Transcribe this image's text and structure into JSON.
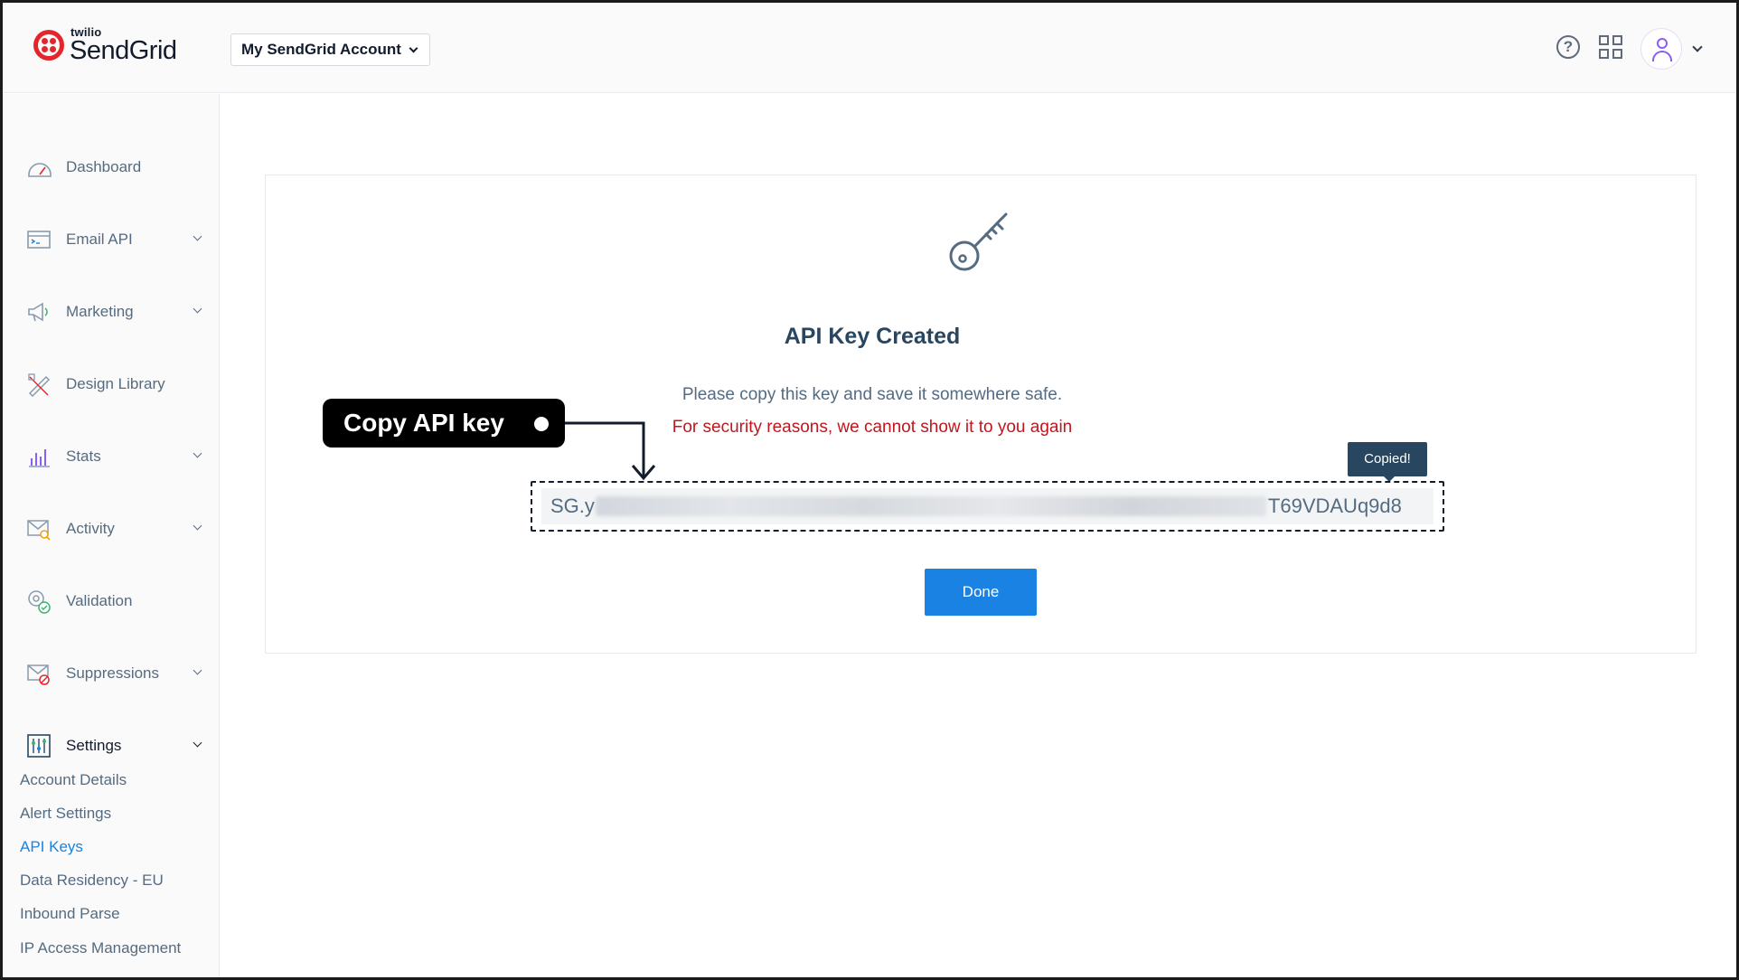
{
  "header": {
    "logo_small": "twilio",
    "logo_main": "SendGrid",
    "account_label": "My SendGrid Account",
    "help_glyph": "?"
  },
  "sidebar": {
    "items": [
      {
        "label": "Dashboard",
        "icon": "dashboard-gauge-icon",
        "expandable": false
      },
      {
        "label": "Email API",
        "icon": "terminal-window-icon",
        "expandable": true
      },
      {
        "label": "Marketing",
        "icon": "megaphone-icon",
        "expandable": true
      },
      {
        "label": "Design Library",
        "icon": "pencil-ruler-icon",
        "expandable": false
      },
      {
        "label": "Stats",
        "icon": "bar-chart-icon",
        "expandable": true
      },
      {
        "label": "Activity",
        "icon": "envelope-search-icon",
        "expandable": true
      },
      {
        "label": "Validation",
        "icon": "at-sign-check-icon",
        "expandable": false
      },
      {
        "label": "Suppressions",
        "icon": "envelope-block-icon",
        "expandable": true
      },
      {
        "label": "Settings",
        "icon": "sliders-icon",
        "expandable": true
      }
    ],
    "settings_subitems": [
      "Account Details",
      "Alert Settings",
      "API Keys",
      "Data Residency - EU",
      "Inbound Parse",
      "IP Access Management"
    ],
    "selected_subitem": "API Keys"
  },
  "main": {
    "title": "API Key Created",
    "message": "Please copy this key and save it somewhere safe.",
    "warning": "For security reasons, we cannot show it to you again",
    "key_prefix": "SG.y",
    "key_suffix": "T69VDAUq9d8",
    "copied_tooltip": "Copied!",
    "done_label": "Done"
  },
  "annotation": {
    "label": "Copy API key"
  },
  "colors": {
    "primary": "#1a82e2",
    "warning": "#c0161d",
    "heading": "#294661",
    "sidebar_text": "#546b81",
    "brand_red": "#e4262c"
  }
}
